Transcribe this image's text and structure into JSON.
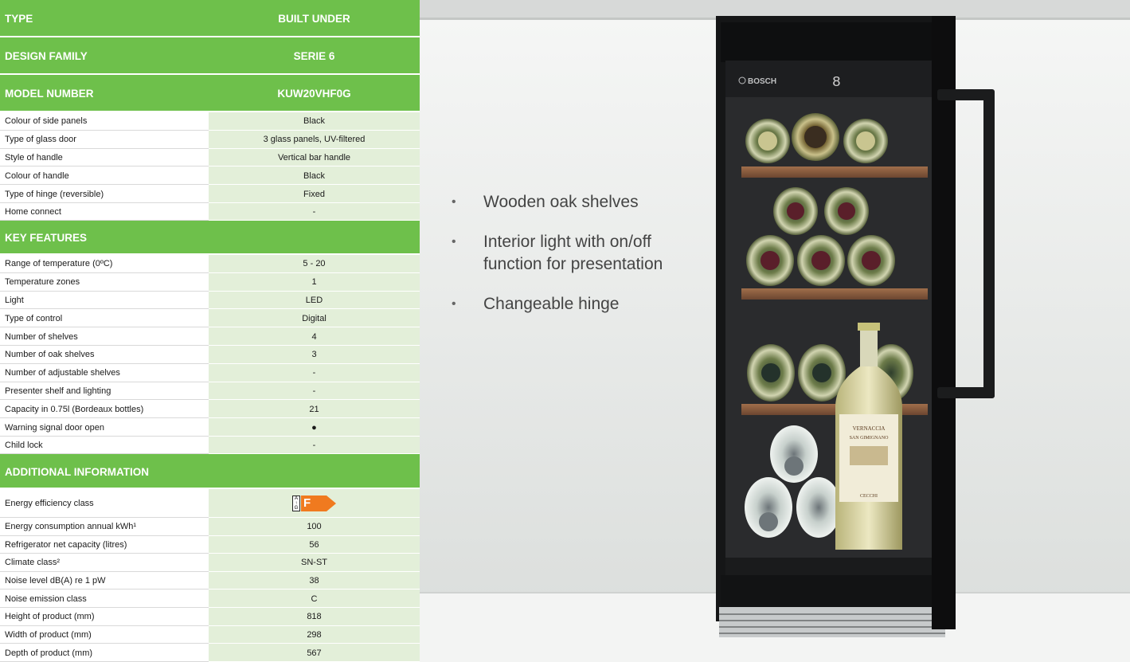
{
  "spec": {
    "type_label": "TYPE",
    "type_value": "BUILT UNDER",
    "family_label": "DESIGN FAMILY",
    "family_value": "SERIE 6",
    "model_label": "MODEL NUMBER",
    "model_value": "KUW20VHF0G",
    "design_rows": [
      {
        "label": "Colour of side panels",
        "value": "Black"
      },
      {
        "label": "Type of glass door",
        "value": "3 glass panels, UV-filtered"
      },
      {
        "label": "Style of handle",
        "value": "Vertical bar handle"
      },
      {
        "label": "Colour of handle",
        "value": "Black"
      },
      {
        "label": "Type of hinge (reversible)",
        "value": "Fixed"
      },
      {
        "label": "Home connect",
        "value": "-"
      }
    ],
    "key_features_label": "KEY FEATURES",
    "feature_rows": [
      {
        "label": "Range of temperature (0ºC)",
        "value": "5 - 20"
      },
      {
        "label": "Temperature zones",
        "value": "1"
      },
      {
        "label": "Light",
        "value": "LED"
      },
      {
        "label": "Type of control",
        "value": "Digital"
      },
      {
        "label": "Number of shelves",
        "value": "4"
      },
      {
        "label": "Number of oak shelves",
        "value": "3"
      },
      {
        "label": "Number of adjustable shelves",
        "value": "-"
      },
      {
        "label": "Presenter shelf and lighting",
        "value": "-"
      },
      {
        "label": "Capacity in 0.75l (Bordeaux bottles)",
        "value": "21"
      },
      {
        "label": "Warning signal door open",
        "value": "●"
      },
      {
        "label": "Child lock",
        "value": "-"
      }
    ],
    "additional_label": "ADDITIONAL INFORMATION",
    "energy_row": {
      "label": "Energy efficiency class",
      "scale_top": "A",
      "scale_arrow": "↑",
      "scale_bottom": "G",
      "class_letter": "F",
      "class_color": "#f07a1f"
    },
    "additional_rows": [
      {
        "label": "Energy consumption annual kWh¹",
        "value": "100"
      },
      {
        "label": "Refrigerator net capacity (litres)",
        "value": "56"
      },
      {
        "label": "Climate class²",
        "value": "SN-ST"
      },
      {
        "label": "Noise level dB(A) re 1 pW",
        "value": "38"
      },
      {
        "label": "Noise emission class",
        "value": "C"
      },
      {
        "label": "Height of product (mm)",
        "value": "818"
      },
      {
        "label": "Width of product (mm)",
        "value": "298"
      },
      {
        "label": "Depth of product (mm)",
        "value": "567"
      }
    ]
  },
  "photo": {
    "bullets": [
      "Wooden oak shelves",
      "Interior light with on/off function for presentation",
      "Changeable hinge"
    ],
    "bullet_marker": "•",
    "brand_label": "BOSCH",
    "display_text": "8",
    "wine_label_line1": "VERNACCIA",
    "wine_label_line2": "SAN GIMIGNANO",
    "wine_producer": "CECCHI"
  },
  "colors": {
    "header_green": "#6ec04b",
    "value_cell_green": "#e3efd9"
  }
}
